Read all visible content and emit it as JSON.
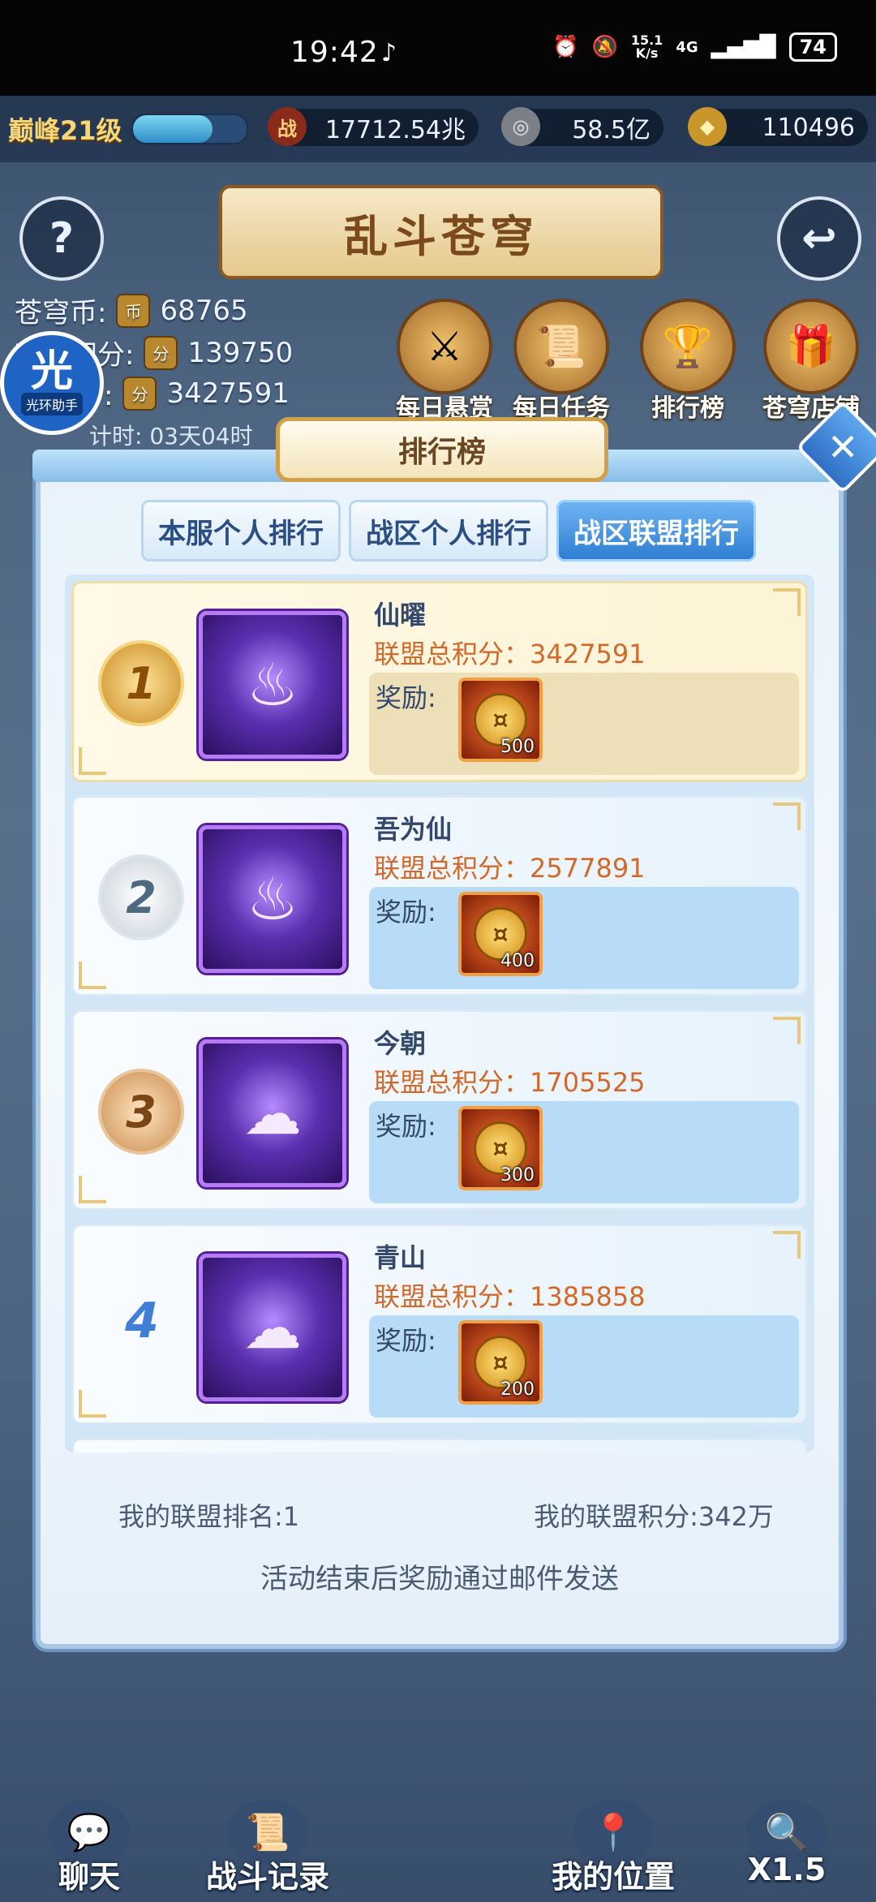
{
  "status_bar": {
    "time": "19:42",
    "tiktok_icon": "♪",
    "alarm_icon": "⏰",
    "mute_icon": "🔕",
    "net_speed_top": "15.1",
    "net_speed_bottom": "K/s",
    "net_type": "4G",
    "signal": "▂▄▆█",
    "battery": "74"
  },
  "top_bar": {
    "peak_level": "巅峰21级",
    "exp_ratio": 0.7,
    "power_icon": "战",
    "power": "17712.54兆",
    "silver_icon": "◎",
    "silver": "58.5亿",
    "gold_icon": "◆",
    "gold": "110496"
  },
  "scene": {
    "title": "乱斗苍穹",
    "help_label": "?",
    "back_label": "↩",
    "currencies": [
      {
        "label": "苍穹币:",
        "value": "68765"
      },
      {
        "label": "苍穹积分:",
        "value": "139750"
      },
      {
        "label": "积分:",
        "value": "3427591"
      }
    ],
    "countdown": "计时: 03天04时",
    "functions": [
      {
        "label": "每日悬赏",
        "icon": "⚔"
      },
      {
        "label": "每日任务",
        "icon": "📜"
      },
      {
        "label": "排行榜",
        "icon": "🏆"
      },
      {
        "label": "苍穹店铺",
        "icon": "🎁"
      }
    ],
    "helper": {
      "big": "光",
      "small": "光环助手"
    }
  },
  "panel": {
    "title": "排行榜",
    "close_label": "✕",
    "tabs": [
      "本服个人排行",
      "战区个人排行",
      "战区联盟排行"
    ],
    "active_tab": 2,
    "score_label": "联盟总积分：",
    "reward_label": "奖励:",
    "rows": [
      {
        "rank": "1",
        "name": "仙曜",
        "score": "3427591",
        "reward_qty": "500",
        "emblem": "flame"
      },
      {
        "rank": "2",
        "name": "吾为仙",
        "score": "2577891",
        "reward_qty": "400",
        "emblem": "flame"
      },
      {
        "rank": "3",
        "name": "今朝",
        "score": "1705525",
        "reward_qty": "300",
        "emblem": "orb"
      },
      {
        "rank": "4",
        "name": "青山",
        "score": "1385858",
        "reward_qty": "200",
        "emblem": "orb"
      }
    ],
    "my_rank": "我的联盟排名:1",
    "my_score": "我的联盟积分:342万",
    "notice": "活动结束后奖励通过邮件发送"
  },
  "bottom_nav": [
    {
      "label": "聊天",
      "icon": "💬"
    },
    {
      "label": "战斗记录",
      "icon": "📜"
    },
    {
      "label": "我的位置",
      "icon": "📍"
    },
    {
      "label": "X1.5",
      "icon": "🔍"
    }
  ],
  "colors": {
    "accent_blue": "#2f7ed3",
    "score_orange": "#d2692a",
    "gold": "#c98b24"
  }
}
